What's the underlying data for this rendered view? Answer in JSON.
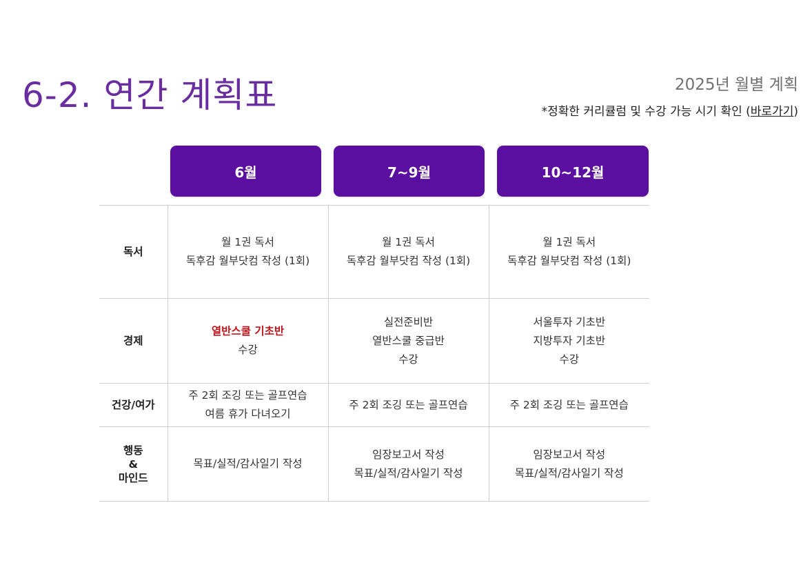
{
  "header": {
    "title": "6-2. 연간 계획표",
    "subtitle": "2025년 월별 계획",
    "note_prefix": "*정확한 커리큘럼 및 수강 가능 시기 확인 (",
    "note_link": "바로가기",
    "note_suffix": ")"
  },
  "months": [
    "6월",
    "7~9월",
    "10~12월"
  ],
  "rows": [
    {
      "label": [
        "독서"
      ],
      "cells": [
        [
          "월 1권 독서",
          "독후감 월부닷컴 작성 (1회)"
        ],
        [
          "월 1권 독서",
          "독후감 월부닷컴 작성 (1회)"
        ],
        [
          "월 1권 독서",
          "독후감 월부닷컴 작성 (1회)"
        ]
      ]
    },
    {
      "label": [
        "경제"
      ],
      "cells": [
        [
          "열반스쿨 기초반",
          "수강"
        ],
        [
          "실전준비반",
          "열반스쿨 중급반",
          "수강"
        ],
        [
          "서울투자 기초반",
          "지방투자 기초반",
          "수강"
        ]
      ],
      "highlight": "열반스쿨 기초반",
      "highlight_color": "#c0141b"
    },
    {
      "label": [
        "건강/여가"
      ],
      "cells": [
        [
          "주 2회 조깅 또는 골프연습",
          "여름 휴가 다녀오기"
        ],
        [
          "주 2회 조깅 또는 골프연습"
        ],
        [
          "주 2회 조깅 또는 골프연습"
        ]
      ]
    },
    {
      "label": [
        "행동",
        "&",
        "마인드"
      ],
      "cells": [
        [
          "목표/실적/감사일기 작성"
        ],
        [
          "임장보고서 작성",
          "목표/실적/감사일기 작성"
        ],
        [
          "임장보고서 작성",
          "목표/실적/감사일기 작성"
        ]
      ]
    }
  ],
  "colors": {
    "title": "#6a2da0",
    "month_header_bg": "#5a0fa0",
    "highlight": "#c0141b"
  }
}
